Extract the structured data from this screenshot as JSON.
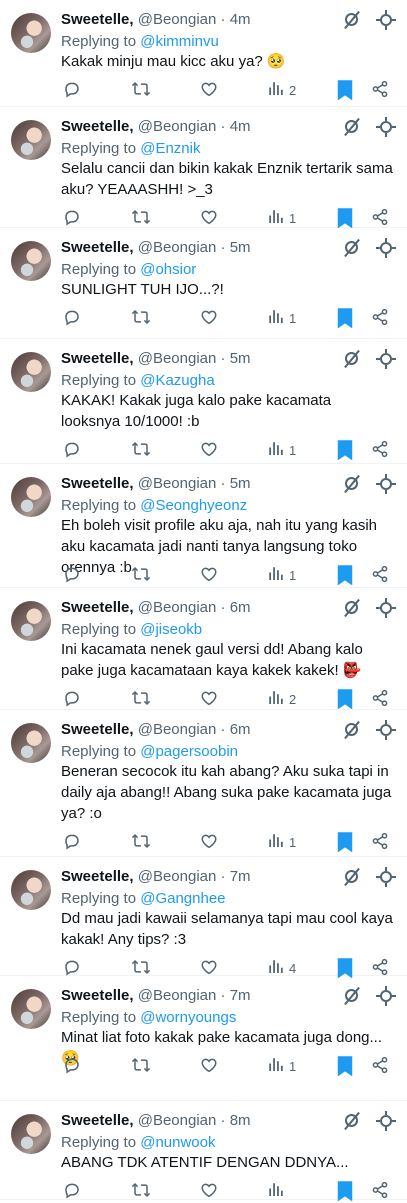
{
  "colors": {
    "link": "#1d9bf0",
    "muted": "#536471",
    "bookmark": "#1d9bf0"
  },
  "icons": [
    "reply-icon",
    "retweet-icon",
    "like-icon",
    "views-icon",
    "bookmark-icon",
    "share-icon",
    "more-icon",
    "settings-icon"
  ],
  "tweets": [
    {
      "name": "Sweetelle,",
      "handle": "@Beongian",
      "dot": "·",
      "time": "4m",
      "replying_prefix": "Replying to",
      "replying_to": "@kimminvu",
      "text": "Kakak minju mau kicc aku ya? 🥺",
      "views": "2"
    },
    {
      "name": "Sweetelle,",
      "handle": "@Beongian",
      "dot": "·",
      "time": "4m",
      "replying_prefix": "Replying to",
      "replying_to": "@Enznik",
      "text": "Selalu cancii dan bikin kakak Enznik tertarik sama aku? YEAAASHH! >_3",
      "views": "1"
    },
    {
      "name": "Sweetelle,",
      "handle": "@Beongian",
      "dot": "·",
      "time": "5m",
      "replying_prefix": "Replying to",
      "replying_to": "@ohsior",
      "text": "SUNLIGHT TUH IJO...?!",
      "views": "1"
    },
    {
      "name": "Sweetelle,",
      "handle": "@Beongian",
      "dot": "·",
      "time": "5m",
      "replying_prefix": "Replying to",
      "replying_to": "@Kazugha",
      "text": "KAKAK! Kakak juga kalo pake kacamata looksnya 10/1000! :b",
      "views": "1"
    },
    {
      "name": "Sweetelle,",
      "handle": "@Beongian",
      "dot": "·",
      "time": "5m",
      "replying_prefix": "Replying to",
      "replying_to": "@Seonghyeonz",
      "text": "Eh boleh visit profile aku aja, nah itu yang kasih aku kacamata jadi nanti tanya langsung toko orennya :b",
      "views": "1"
    },
    {
      "name": "Sweetelle,",
      "handle": "@Beongian",
      "dot": "·",
      "time": "6m",
      "replying_prefix": "Replying to",
      "replying_to": "@jiseokb",
      "text": "Ini kacamata nenek gaul versi dd! Abang kalo pake juga kacamataan kaya kakek kakek! 👺",
      "views": "2"
    },
    {
      "name": "Sweetelle,",
      "handle": "@Beongian",
      "dot": "·",
      "time": "6m",
      "replying_prefix": "Replying to",
      "replying_to": "@pagersoobin",
      "text": "Beneran secocok itu kah abang? Aku suka tapi in daily aja abang!! Abang suka pake kacamata juga ya? :o",
      "views": "1"
    },
    {
      "name": "Sweetelle,",
      "handle": "@Beongian",
      "dot": "·",
      "time": "7m",
      "replying_prefix": "Replying to",
      "replying_to": "@Gangnhee",
      "text": "Dd mau jadi kawaii selamanya tapi mau cool kaya kakak! Any tips? :3",
      "views": "4"
    },
    {
      "name": "Sweetelle,",
      "handle": "@Beongian",
      "dot": "·",
      "time": "7m",
      "replying_prefix": "Replying to",
      "replying_to": "@wornyoungs",
      "text": "Minat liat foto kakak pake kacamata juga dong... 🥺",
      "views": "1"
    },
    {
      "name": "Sweetelle,",
      "handle": "@Beongian",
      "dot": "·",
      "time": "8m",
      "replying_prefix": "Replying to",
      "replying_to": "@nunwook",
      "text": "ABANG TDK ATENTIF DENGAN DDNYA...",
      "views": ""
    }
  ]
}
